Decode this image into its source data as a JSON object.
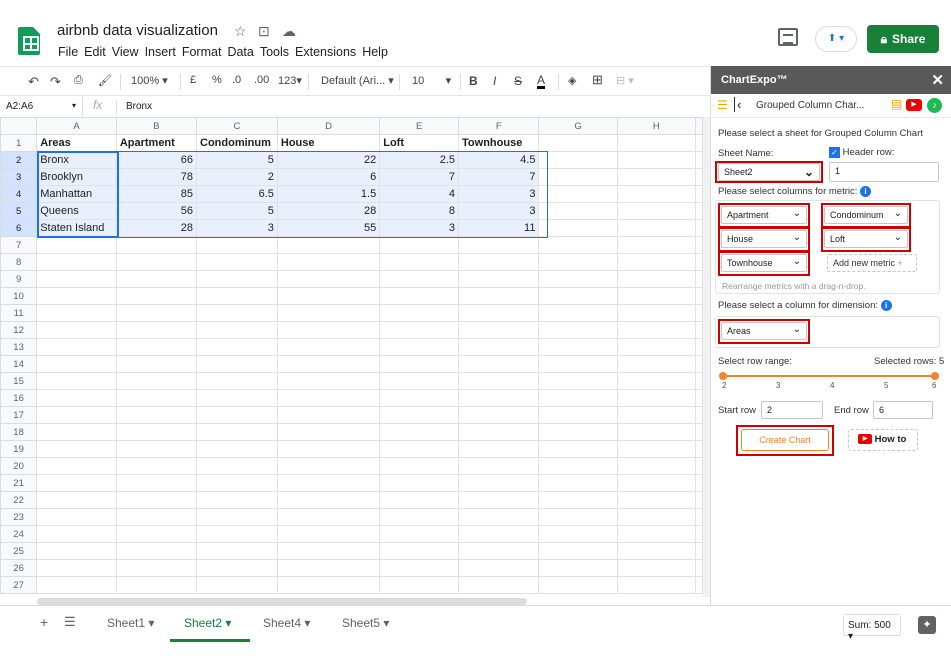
{
  "doc": {
    "title": "airbnb data visualization"
  },
  "menu": [
    "File",
    "Edit",
    "View",
    "Insert",
    "Format",
    "Data",
    "Tools",
    "Extensions",
    "Help"
  ],
  "share_label": "Share",
  "toolbar": {
    "zoom": "100%",
    "currency": "£",
    "percent": "%",
    "dec_less": ".0",
    "dec_more": ".00",
    "format": "123",
    "font": "Default (Ari...",
    "font_size": "10"
  },
  "namebox": "A2:A6",
  "fx": "fx",
  "formula_value": "Bronx",
  "grid": {
    "columns": [
      "A",
      "B",
      "C",
      "D",
      "E",
      "F",
      "G",
      "H"
    ],
    "rows": [
      [
        "Areas",
        "Apartment",
        "Condominum",
        "House",
        "Loft",
        "Townhouse",
        "",
        ""
      ],
      [
        "Bronx",
        "66",
        "5",
        "22",
        "2.5",
        "4.5",
        "",
        ""
      ],
      [
        "Brooklyn",
        "78",
        "2",
        "6",
        "7",
        "7",
        "",
        ""
      ],
      [
        "Manhattan",
        "85",
        "6.5",
        "1.5",
        "4",
        "3",
        "",
        ""
      ],
      [
        "Queens",
        "56",
        "5",
        "28",
        "8",
        "3",
        "",
        ""
      ],
      [
        "Staten Island",
        "28",
        "3",
        "55",
        "3",
        "11",
        "",
        ""
      ]
    ],
    "row_numbers": [
      "1",
      "2",
      "3",
      "4",
      "5",
      "6",
      "7",
      "8",
      "9",
      "10",
      "11",
      "12",
      "13",
      "14",
      "15",
      "16",
      "17",
      "18",
      "19",
      "20",
      "21",
      "22",
      "23",
      "24",
      "25",
      "26",
      "27"
    ]
  },
  "sheets": [
    "Sheet1",
    "Sheet2",
    "Sheet4",
    "Sheet5"
  ],
  "sum": "Sum: 500",
  "panel": {
    "title": "ChartExpo™",
    "nav_title": "Grouped Column Char...",
    "select_sheet_text": "Please select a sheet for Grouped Column Chart",
    "sheet_name_label": "Sheet Name:",
    "header_row_label": "Header row:",
    "sheet_value": "Sheet2",
    "header_row_value": "1",
    "metric_label": "Please select columns for metric:",
    "metrics": [
      "Apartment",
      "Condominum",
      "House",
      "Loft",
      "Townhouse"
    ],
    "add_metric": "Add new metric",
    "rearrange_hint": "Rearrange metrics with a drag-n-drop.",
    "dimension_label": "Please select a column for dimension:",
    "dimension_value": "Areas",
    "row_range_label": "Select row range:",
    "selected_rows": "Selected rows: 5",
    "slider_ticks": [
      "2",
      "3",
      "4",
      "5",
      "6"
    ],
    "start_row_label": "Start row",
    "start_row": "2",
    "end_row_label": "End row",
    "end_row": "6",
    "create_chart": "Create Chart",
    "how_to": "How to"
  }
}
